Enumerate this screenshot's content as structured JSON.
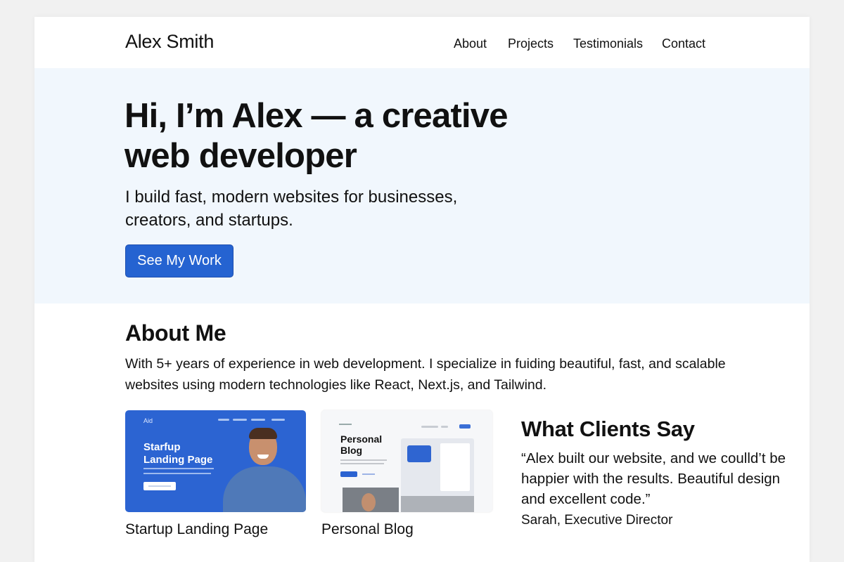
{
  "header": {
    "logo": "Alex Smith",
    "nav": [
      "About",
      "Projects",
      "Testimonials",
      "Contact"
    ]
  },
  "hero": {
    "title": "Hi, I’m Alex — a creative web developer",
    "subtitle": "I build fast, modern websites for businesses, creators, and startups.",
    "cta": "See My Work"
  },
  "about": {
    "title": "About Me",
    "text": "With 5+ years of experience in web development. I specialize in fuiding beautiful, fast, and scalable websites using modern technologies like React, Next.js, and Tailwind."
  },
  "projects": [
    {
      "caption": "Startup Landing Page",
      "thumb_logo": "Aid",
      "thumb_title": "Starfup Landing Page"
    },
    {
      "caption": "Personal Blog",
      "thumb_title": "Personal Blog"
    }
  ],
  "testimonials": {
    "title": "What Clients Say",
    "quote": "“Alex built our website, and we coulld’t be happier with the results. Beautiful design and excellent code.”",
    "author": "Sarah, Executive Director"
  },
  "colors": {
    "accent": "#2563d1",
    "hero_bg": "#f1f7fd",
    "page_bg": "#ffffff"
  }
}
